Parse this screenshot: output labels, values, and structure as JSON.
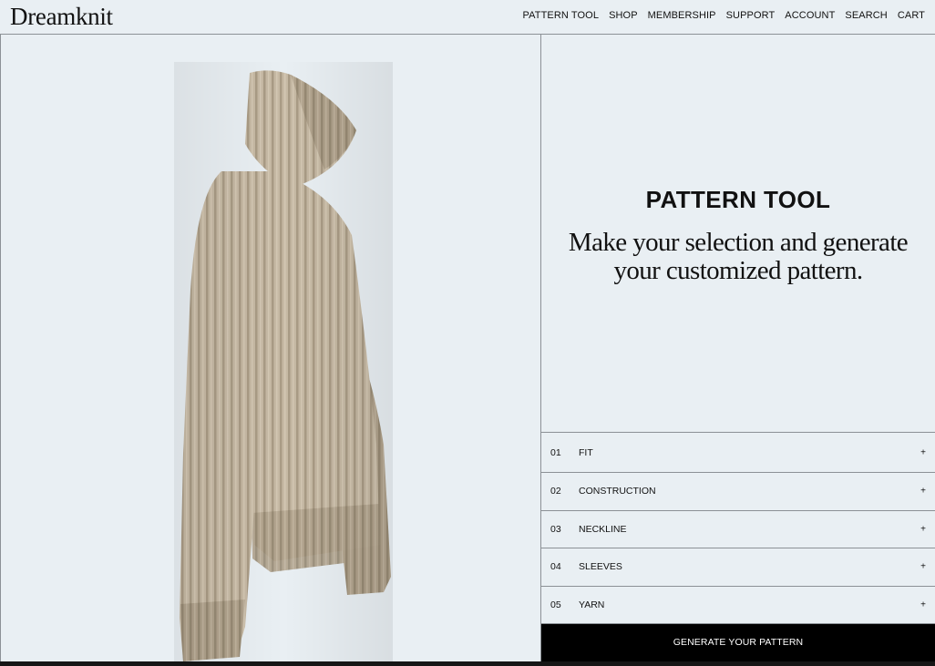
{
  "header": {
    "logo": "Dreamknit",
    "nav": [
      "PATTERN TOOL",
      "SHOP",
      "MEMBERSHIP",
      "SUPPORT",
      "ACCOUNT",
      "SEARCH",
      "CART"
    ]
  },
  "main": {
    "title": "PATTERN TOOL",
    "subtitle_line1": "Make your selection and generate",
    "subtitle_line2": "your customized pattern.",
    "options": [
      {
        "num": "01",
        "label": "FIT",
        "icon": "+"
      },
      {
        "num": "02",
        "label": "CONSTRUCTION",
        "icon": "+"
      },
      {
        "num": "03",
        "label": "NECKLINE",
        "icon": "+"
      },
      {
        "num": "04",
        "label": "SLEEVES",
        "icon": "+"
      },
      {
        "num": "05",
        "label": "YARN",
        "icon": "+"
      }
    ],
    "generate_label": "GENERATE YOUR PATTERN"
  },
  "colors": {
    "background": "#e9eff3",
    "sweater": "#c4b7a2",
    "button": "#000000"
  }
}
